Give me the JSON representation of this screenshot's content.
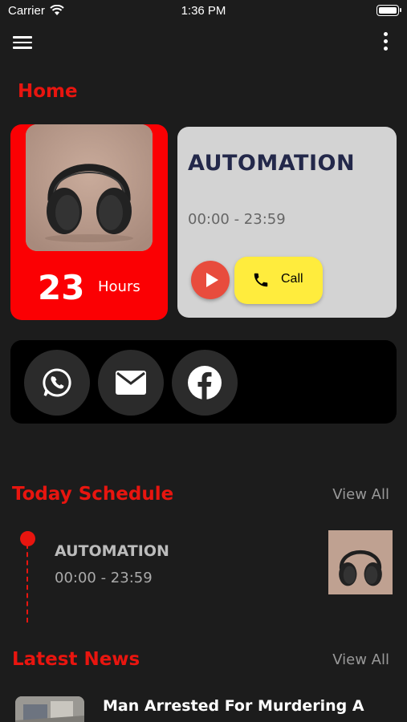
{
  "status_bar": {
    "carrier": "Carrier",
    "time": "1:36 PM"
  },
  "header": {
    "menu_icon": "hamburger-icon",
    "more_icon": "more-vertical-icon"
  },
  "page_title": "Home",
  "hero": {
    "image": "headphones-photo",
    "hours_value": "23",
    "hours_label": "Hours"
  },
  "info_card": {
    "title": "AUTOMATION",
    "time_range": "00:00 - 23:59",
    "call_label": "Call"
  },
  "social": [
    {
      "name": "whatsapp-icon"
    },
    {
      "name": "mail-icon"
    },
    {
      "name": "facebook-icon"
    }
  ],
  "schedule": {
    "section_title": "Today Schedule",
    "view_all": "View All",
    "items": [
      {
        "title": "AUTOMATION",
        "time": "00:00 - 23:59"
      }
    ]
  },
  "news": {
    "section_title": "Latest News",
    "view_all": "View All",
    "items": [
      {
        "title": "Man Arrested For Murdering A"
      }
    ]
  },
  "colors": {
    "accent": "#e8150f",
    "hero_red": "#fb0003",
    "call_yellow": "#ffec3d",
    "background": "#1c1c1c"
  }
}
